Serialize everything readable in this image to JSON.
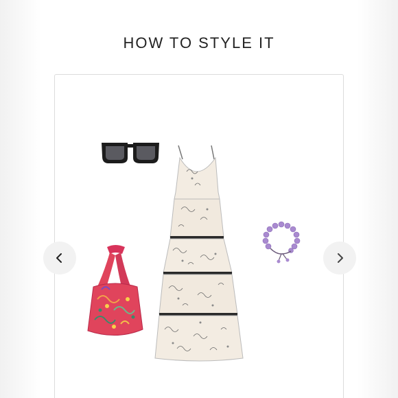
{
  "heading": {
    "title": "HOW TO STYLE IT"
  },
  "carousel": {
    "prev_icon": "chevron-left-icon",
    "next_icon": "chevron-right-icon",
    "items": [
      {
        "name": "sunglasses",
        "icon": "sunglasses-icon"
      },
      {
        "name": "maxi-dress",
        "icon": "dress-icon"
      },
      {
        "name": "bracelet",
        "icon": "bracelet-icon"
      },
      {
        "name": "handbag",
        "icon": "bag-icon"
      }
    ]
  },
  "colors": {
    "heading_text": "#222222",
    "card_border": "#dcdcdc",
    "nav_button_bg": "#f2f2f2",
    "dress": "#f3ece2",
    "bag": "#e0445c",
    "bracelet": "#a98ad0",
    "sunglasses": "#1c1c1c"
  }
}
